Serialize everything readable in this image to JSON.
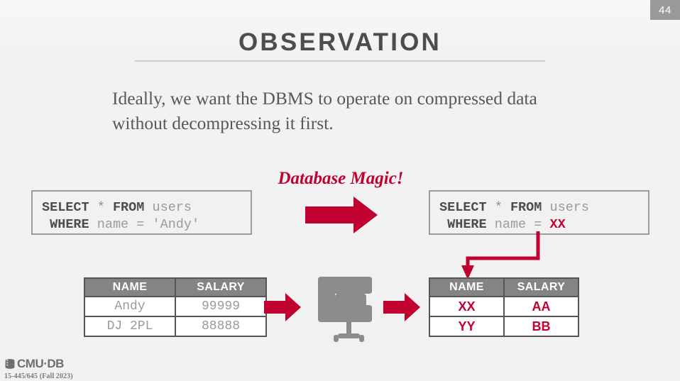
{
  "slide": {
    "page_number": "44",
    "title": "OBSERVATION",
    "body_text": "Ideally, we want the DBMS to operate on compressed data without decompressing it first.",
    "magic_label": "Database Magic!",
    "accent_color": "#c10230",
    "title_color": "#4d4d4d",
    "body_color": "#58585a",
    "header_fill": "#848484"
  },
  "sql_left": {
    "name": "original-query",
    "line1": {
      "select": "SELECT",
      "star": "*",
      "from": "FROM",
      "table": "users"
    },
    "line2": {
      "where": "WHERE",
      "column": "name",
      "operator": "=",
      "value": "'Andy'"
    }
  },
  "sql_right": {
    "name": "compressed-query",
    "line1": {
      "select": "SELECT",
      "star": "*",
      "from": "FROM",
      "table": "users"
    },
    "line2": {
      "where": "WHERE",
      "column": "name",
      "operator": "=",
      "value": "XX"
    }
  },
  "table_left": {
    "name": "uncompressed-table",
    "columns": [
      "NAME",
      "SALARY"
    ],
    "rows": [
      [
        "Andy",
        "99999"
      ],
      [
        "DJ 2PL",
        "88888"
      ]
    ]
  },
  "table_right": {
    "name": "compressed-table",
    "columns": [
      "NAME",
      "SALARY"
    ],
    "rows": [
      [
        "XX",
        "AA"
      ],
      [
        "YY",
        "BB"
      ]
    ]
  },
  "icons": {
    "clamp": "compression-clamp-icon",
    "main_arrow": "right-arrow-icon",
    "small_arrow_left": "right-arrow-icon",
    "small_arrow_right": "right-arrow-icon",
    "elbow": "elbow-connector-arrow-icon",
    "logo": "cmu-db-database-icon"
  },
  "footer": {
    "wordmark": "CMU·DB",
    "course": "15-445/645 (Fall 2023)"
  }
}
